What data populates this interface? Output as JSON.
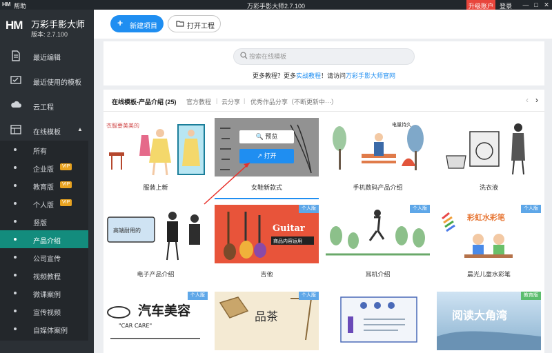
{
  "titlebar": {
    "logo": "HM",
    "help": "帮助",
    "title": "万彩手影大师2.7.100",
    "upgrade": "升级账户",
    "login": "登录",
    "minimize": "—",
    "maximize": "□",
    "close": "✕"
  },
  "brand": {
    "mark": "HM",
    "name": "万彩手影大师",
    "version": "版本: 2.7.100"
  },
  "sidebar": {
    "items": [
      {
        "label": "最近编辑",
        "icon": "document-icon"
      },
      {
        "label": "最近使用的模板",
        "icon": "checklist-icon"
      },
      {
        "label": "云工程",
        "icon": "cloud-icon"
      },
      {
        "label": "在线模板",
        "icon": "template-icon"
      }
    ],
    "submenu": [
      {
        "label": "所有",
        "vip": ""
      },
      {
        "label": "企业版",
        "vip": "VIP"
      },
      {
        "label": "教育版",
        "vip": "VIP"
      },
      {
        "label": "个人版",
        "vip": "VIP"
      },
      {
        "label": "竖版",
        "vip": ""
      },
      {
        "label": "产品介绍",
        "vip": "",
        "active": true
      },
      {
        "label": "公司宣传",
        "vip": ""
      },
      {
        "label": "视频教程",
        "vip": ""
      },
      {
        "label": "微课案例",
        "vip": ""
      },
      {
        "label": "宣传视频",
        "vip": ""
      },
      {
        "label": "自媒体案例",
        "vip": ""
      }
    ]
  },
  "toolbar": {
    "new_label": "新建项目",
    "open_label": "打开工程"
  },
  "search": {
    "placeholder": "搜索在线模板",
    "help_prefix": "更多教程？更多",
    "help_link1": "实战教程",
    "help_mid": "！请访问",
    "help_link2": "万彩手影大师官网"
  },
  "tabs": {
    "current": "在线模板-产品介绍 (25)",
    "items": [
      "官方教程",
      "云分享",
      "优秀作品分享（不断更新中···）"
    ]
  },
  "cards": [
    {
      "caption": "服装上新",
      "tag": ""
    },
    {
      "caption": "女鞋新款式",
      "tag": ""
    },
    {
      "caption": "手机数码产品介绍",
      "tag": ""
    },
    {
      "caption": "洗衣液",
      "tag": ""
    },
    {
      "caption": "电子产品介绍",
      "tag": ""
    },
    {
      "caption": "吉他",
      "tag": "个人版"
    },
    {
      "caption": "耳机介绍",
      "tag": "个人版"
    },
    {
      "caption": "晨光儿童水彩笔",
      "tag": "个人版"
    },
    {
      "caption": "",
      "tag": "个人版"
    },
    {
      "caption": "",
      "tag": "个人版"
    },
    {
      "caption": "",
      "tag": ""
    },
    {
      "caption": "",
      "tag": "教育版"
    }
  ],
  "thumb_text": {
    "c1": "衣服要美美的",
    "c2_tag": "电量持久",
    "c5_label": "高端耐用的",
    "c6_guitar": "Guitar",
    "c6_sub": "商品内容运用",
    "c8": "彩虹水彩笔",
    "c9_title": "汽车美容",
    "c9_sub": "\"CAR CARE\"",
    "c10": "品茶",
    "c12": "阅读大角湾"
  },
  "hover": {
    "preview": "预览",
    "open": "打开"
  },
  "colors": {
    "accent": "#1f8ef1",
    "sidebar": "#2b3035",
    "active": "#138c7d",
    "vip": "#e8a321",
    "upgrade": "#e8453c"
  }
}
